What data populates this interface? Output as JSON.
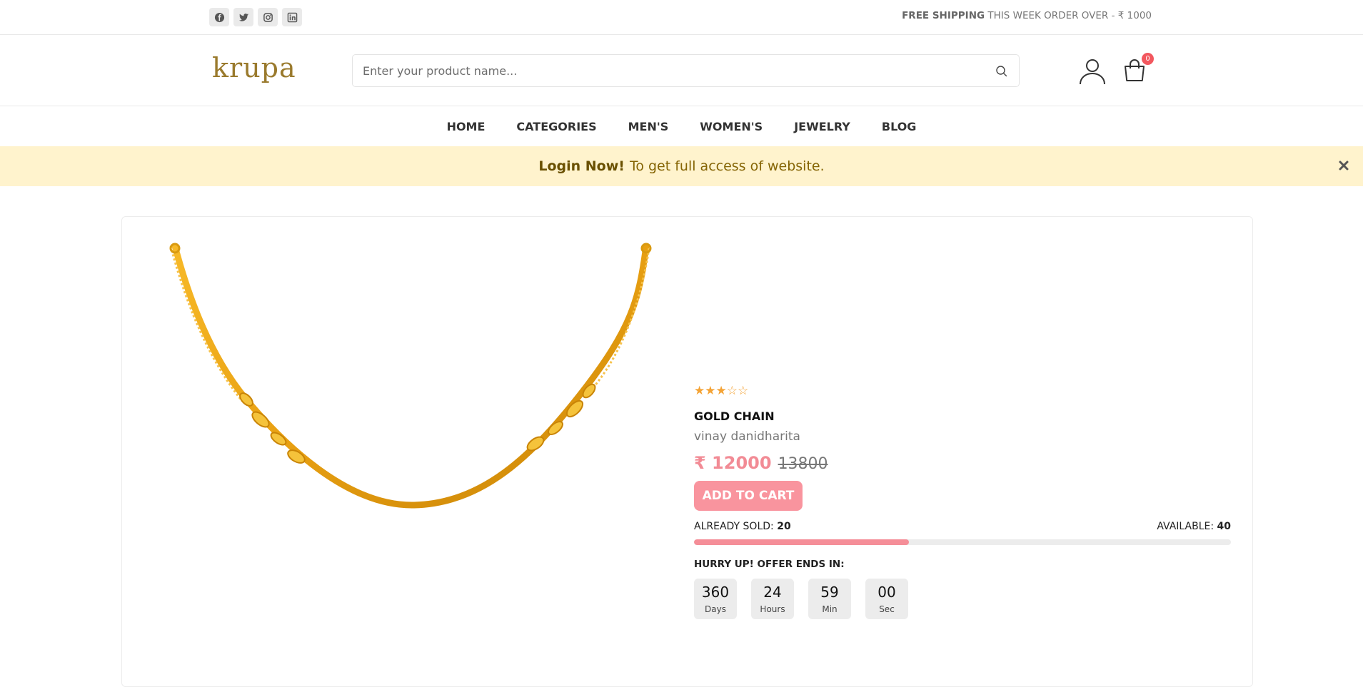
{
  "topbar": {
    "socials": [
      "facebook-icon",
      "twitter-icon",
      "instagram-icon",
      "linkedin-icon"
    ],
    "shipping_bold": "FREE SHIPPING",
    "shipping_text": "THIS WEEK ORDER OVER - ₹ 1000"
  },
  "header": {
    "logo": "krupa",
    "search_placeholder": "Enter your product name...",
    "cart_count": "0"
  },
  "nav": {
    "items": [
      "HOME",
      "CATEGORIES",
      "MEN'S",
      "WOMEN'S",
      "JEWELRY",
      "BLOG"
    ]
  },
  "alert": {
    "bold": "Login Now!",
    "text": "To get full access of website."
  },
  "product": {
    "rating": "★★★☆☆",
    "rating_value": 3,
    "rating_max": 5,
    "title": "GOLD CHAIN",
    "vendor": "vinay danidharita",
    "price": "₹ 12000",
    "old_price": "13800",
    "add_to_cart": "ADD TO CART",
    "sold_label": "ALREADY SOLD:",
    "sold": "20",
    "available_label": "AVAILABLE:",
    "available": "40",
    "sold_fraction": 0.4,
    "hurry": "HURRY UP! OFFER ENDS IN:",
    "timer": {
      "days": "360",
      "days_label": "Days",
      "hours": "24",
      "hours_label": "Hours",
      "min": "59",
      "min_label": "Min",
      "sec": "00",
      "sec_label": "Sec"
    }
  },
  "colors": {
    "accent": "#f28b95",
    "logo": "#9a7a2d",
    "alert_bg": "#fff3cd",
    "star": "#f4a335"
  }
}
